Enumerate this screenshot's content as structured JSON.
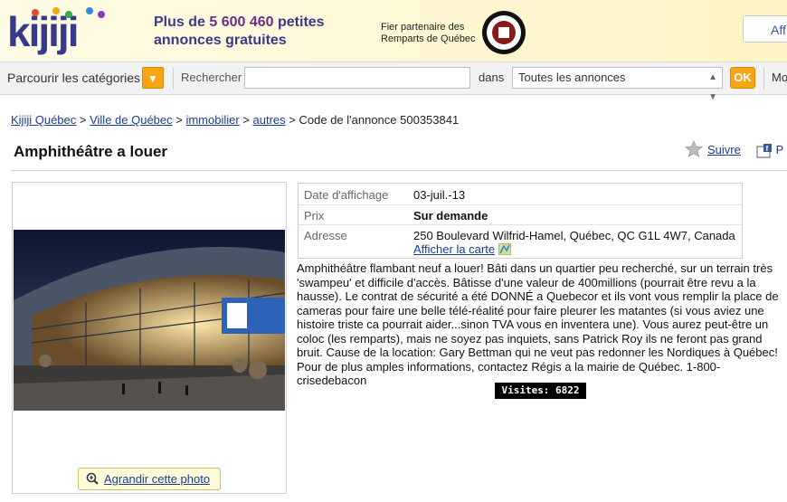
{
  "header": {
    "logo_text": "kijiji",
    "promo_prefix": "Plus de ",
    "promo_count": "5 600 460",
    "promo_suffix": " petites",
    "promo_line2": "annonces gratuites",
    "partner_line1": "Fier partenaire des",
    "partner_line2": "Remparts de Québec",
    "seal_text": "REMPARTS QUÉBEC",
    "top_button_label": "Aff"
  },
  "searchbar": {
    "categories_label": "Parcourir les catégories",
    "search_label": "Rechercher",
    "search_placeholder": "",
    "in_label": "dans",
    "scope_value": "Toutes les annonces",
    "ok_label": "OK",
    "more_label": "Mo"
  },
  "breadcrumb": {
    "items": [
      "Kijiji Québec",
      "Ville de Québec",
      "immobilier",
      "autres"
    ],
    "current": "Code de l'annonce 500353841"
  },
  "listing": {
    "title": "Amphithéâtre a louer",
    "follow_label": "Suivre",
    "share_label": "P",
    "enlarge_label": "Agrandir cette photo",
    "details": {
      "date_label": "Date d'affichage",
      "date_value": "03-juil.-13",
      "price_label": "Prix",
      "price_value": "Sur demande",
      "address_label": "Adresse",
      "address_value": "250 Boulevard Wilfrid-Hamel, Québec, QC G1L 4W7, Canada",
      "map_link": "Afficher la carte"
    },
    "description": "Amphithéâtre flambant neuf a louer! Bâti dans un quartier peu recherché, sur un terrain très 'swampeu' et difficile d'accès. Bâtisse d'une valeur de 400millions (pourrait être revu a la hausse). Le contrat de sécurité a été DONNÉ a Quebecor et ils vont vous remplir la place de cameras pour faire une belle télé-réalité pour faire pleurer les matantes (si vous aviez une histoire triste ca pourrait aider...sinon TVA vous en inventera une). Vous aurez peut-être un coloc (les remparts), mais ne soyez pas inquiets, sans Patrick Roy ils ne feront pas grand bruit. Cause de la location: Gary Bettman qui ne veut pas redonner les Nordiques à Québec! Pour de plus amples informations, contactez Régis a la mairie de Québec. 1-800-crisedebacon",
    "visits": "Visites: 6822"
  },
  "colors": {
    "accent_orange": "#f6a517",
    "link_blue": "#1a3d8f",
    "promo_purple": "#3a3a8c"
  },
  "icons": [
    "star-icon",
    "share-icon",
    "zoom-icon",
    "map-icon",
    "chevron-down-icon"
  ]
}
